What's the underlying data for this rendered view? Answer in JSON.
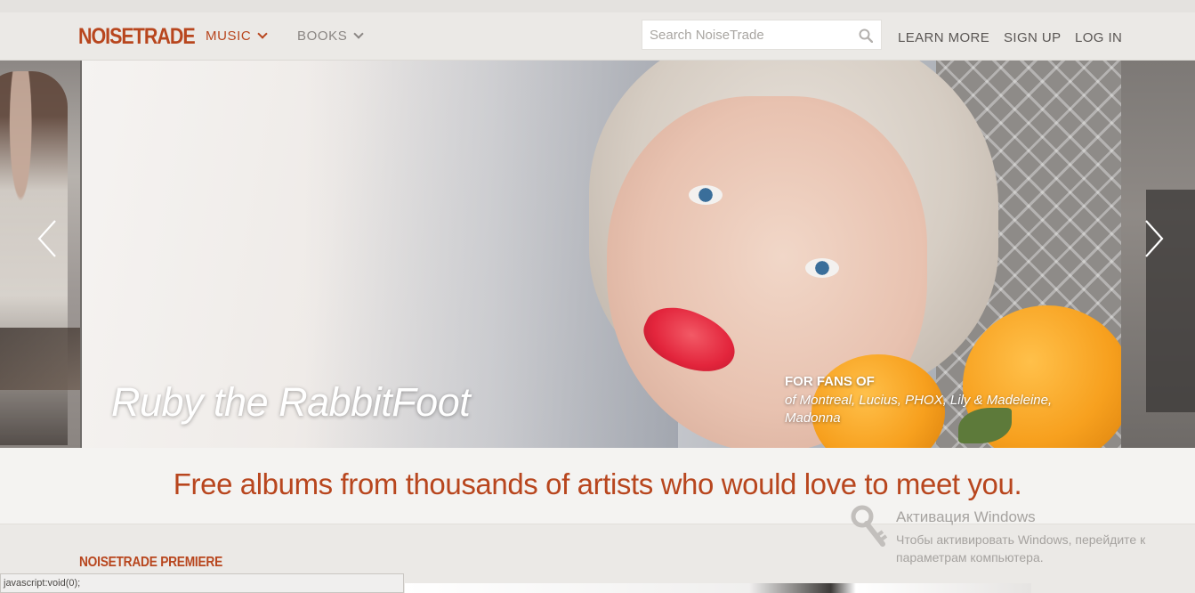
{
  "header": {
    "logo": "NOISETRADE",
    "nav": [
      {
        "label": "MUSIC",
        "active": true
      },
      {
        "label": "BOOKS",
        "active": false
      }
    ],
    "search": {
      "placeholder": "Search NoiseTrade",
      "value": ""
    },
    "links": {
      "learn_more": "LEARN MORE",
      "sign_up": "SIGN UP",
      "log_in": "LOG IN"
    }
  },
  "hero": {
    "artist": "Ruby the RabbitFoot",
    "fans_label": "FOR FANS OF",
    "fans_list": "of Montreal, Lucius, PHOX, Lily & Madeleine, Madonna"
  },
  "tagline": "Free albums from thousands of artists who would love to meet you.",
  "section": {
    "title": "NOISETRADE PREMIERE"
  },
  "status_bar": "javascript:void(0);",
  "watermark": {
    "title": "Активация Windows",
    "text": "Чтобы активировать Windows, перейдите к параметрам компьютера."
  },
  "colors": {
    "brand": "#b8461e",
    "background": "#ebe9e6",
    "band": "#f4f3f1"
  },
  "icons": [
    "search-icon",
    "chevron-down-icon",
    "arrow-left-icon",
    "arrow-right-icon",
    "key-icon"
  ]
}
